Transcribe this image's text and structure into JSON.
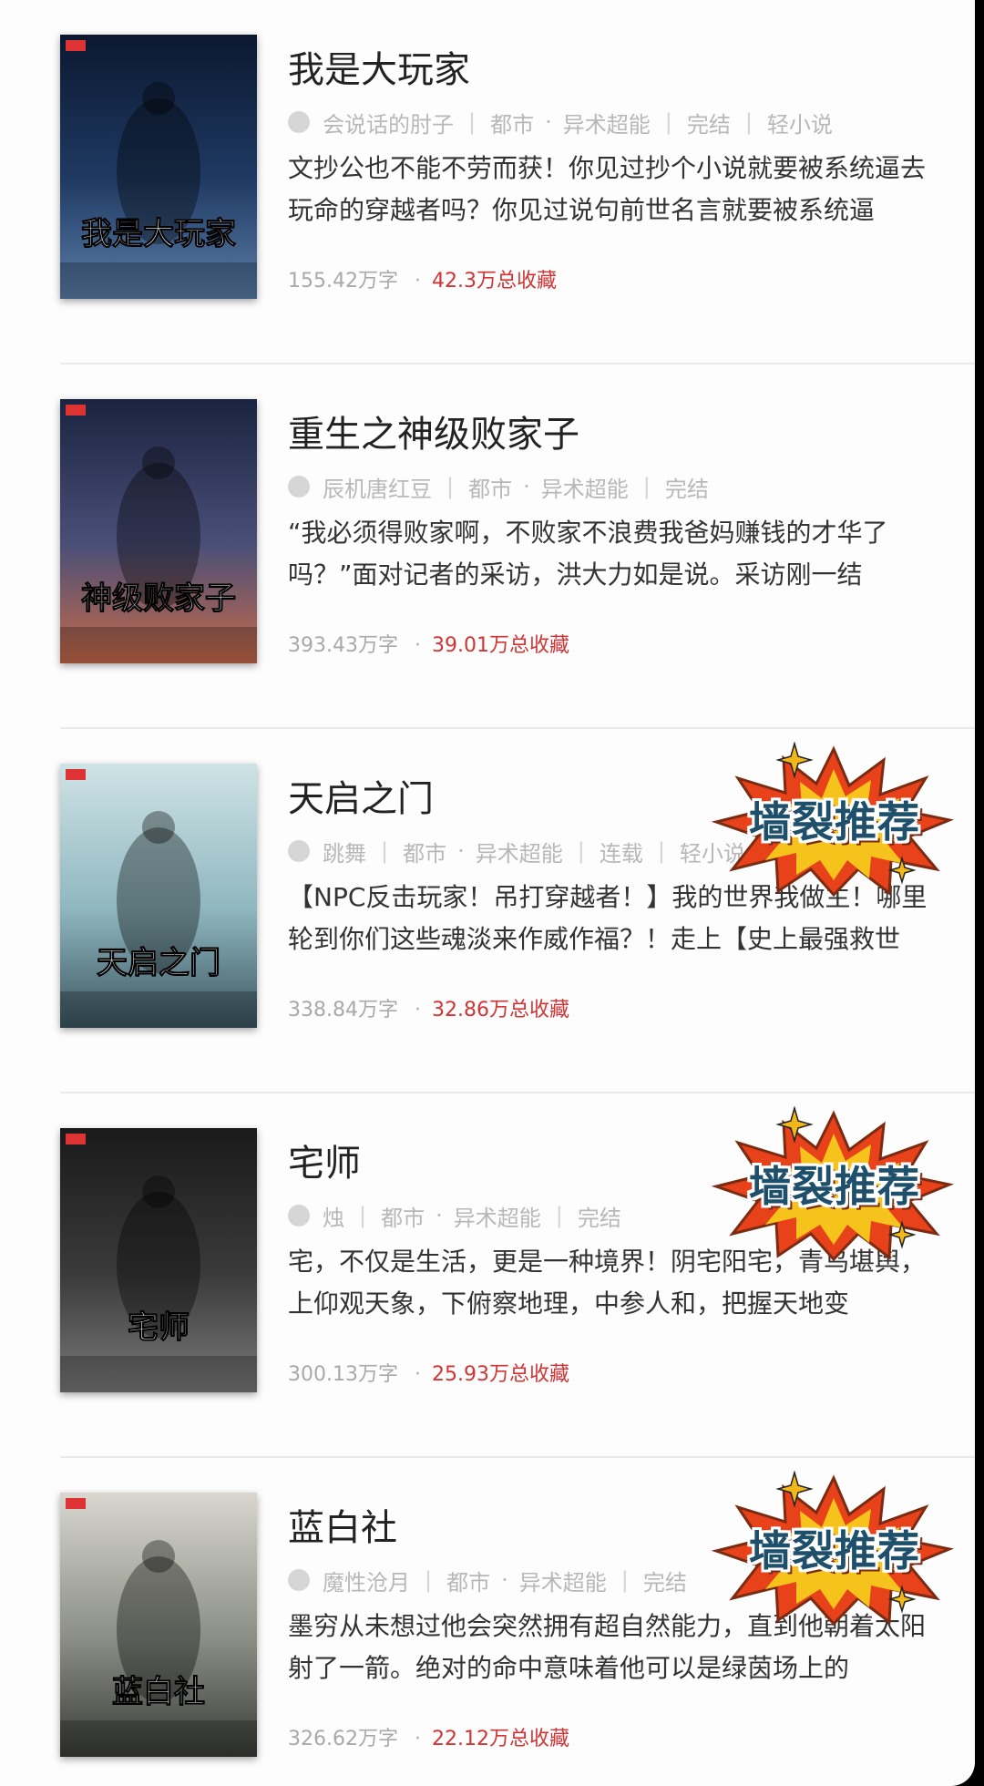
{
  "books": [
    {
      "title": "我是大玩家",
      "author": "会说话的肘子",
      "category": "都市",
      "subcategory": "异术超能",
      "status": "完结",
      "tag": "轻小说",
      "description": "文抄公也不能不劳而获！你见过抄个小说就要被系统逼去玩命的穿越者吗？你见过说句前世名言就要被系统逼",
      "word_count": "155.42万字",
      "favorites": "42.3万总收藏",
      "recommend_badge": "",
      "cover_text": "我是大玩家",
      "cover_palette": [
        "#0b1830",
        "#1f3a63",
        "#5c7fa8"
      ]
    },
    {
      "title": "重生之神级败家子",
      "author": "辰机唐红豆",
      "category": "都市",
      "subcategory": "异术超能",
      "status": "完结",
      "tag": "",
      "description": "“我必须得败家啊，不败家不浪费我爸妈赚钱的才华了吗？”面对记者的采访，洪大力如是说。采访刚一结",
      "word_count": "393.43万字",
      "favorites": "39.01万总收藏",
      "recommend_badge": "",
      "cover_text": "神级败家子",
      "cover_palette": [
        "#1a2440",
        "#4a4f78",
        "#c76a4a"
      ]
    },
    {
      "title": "天启之门",
      "author": "跳舞",
      "category": "都市",
      "subcategory": "异术超能",
      "status": "连载",
      "tag": "轻小说",
      "description": "【NPC反击玩家！吊打穿越者！】我的世界我做主！哪里轮到你们这些魂淡来作威作福？！走上【史上最强救世",
      "word_count": "338.84万字",
      "favorites": "32.86万总收藏",
      "recommend_badge": "墙裂推荐",
      "cover_text": "天启之门",
      "cover_palette": [
        "#cfe3e6",
        "#8fb7bf",
        "#3b5560"
      ]
    },
    {
      "title": "宅师",
      "author": "烛",
      "category": "都市",
      "subcategory": "异术超能",
      "status": "完结",
      "tag": "",
      "description": "宅，不仅是生活，更是一种境界！阴宅阳宅，青乌堪舆，上仰观天象，下俯察地理，中参人和，把握天地变",
      "word_count": "300.13万字",
      "favorites": "25.93万总收藏",
      "recommend_badge": "墙裂推荐",
      "cover_text": "宅师",
      "cover_palette": [
        "#1a1a1a",
        "#3a3a3a",
        "#7a7a7a"
      ]
    },
    {
      "title": "蓝白社",
      "author": "魔性沧月",
      "category": "都市",
      "subcategory": "异术超能",
      "status": "完结",
      "tag": "",
      "description": "墨穷从未想过他会突然拥有超自然能力，直到他朝着太阳射了一箭。绝对的命中意味着他可以是绿茵场上的",
      "word_count": "326.62万字",
      "favorites": "22.12万总收藏",
      "recommend_badge": "墙裂推荐",
      "cover_text": "蓝白社",
      "cover_palette": [
        "#d9d7cf",
        "#8b8f86",
        "#3a3d38"
      ]
    }
  ]
}
